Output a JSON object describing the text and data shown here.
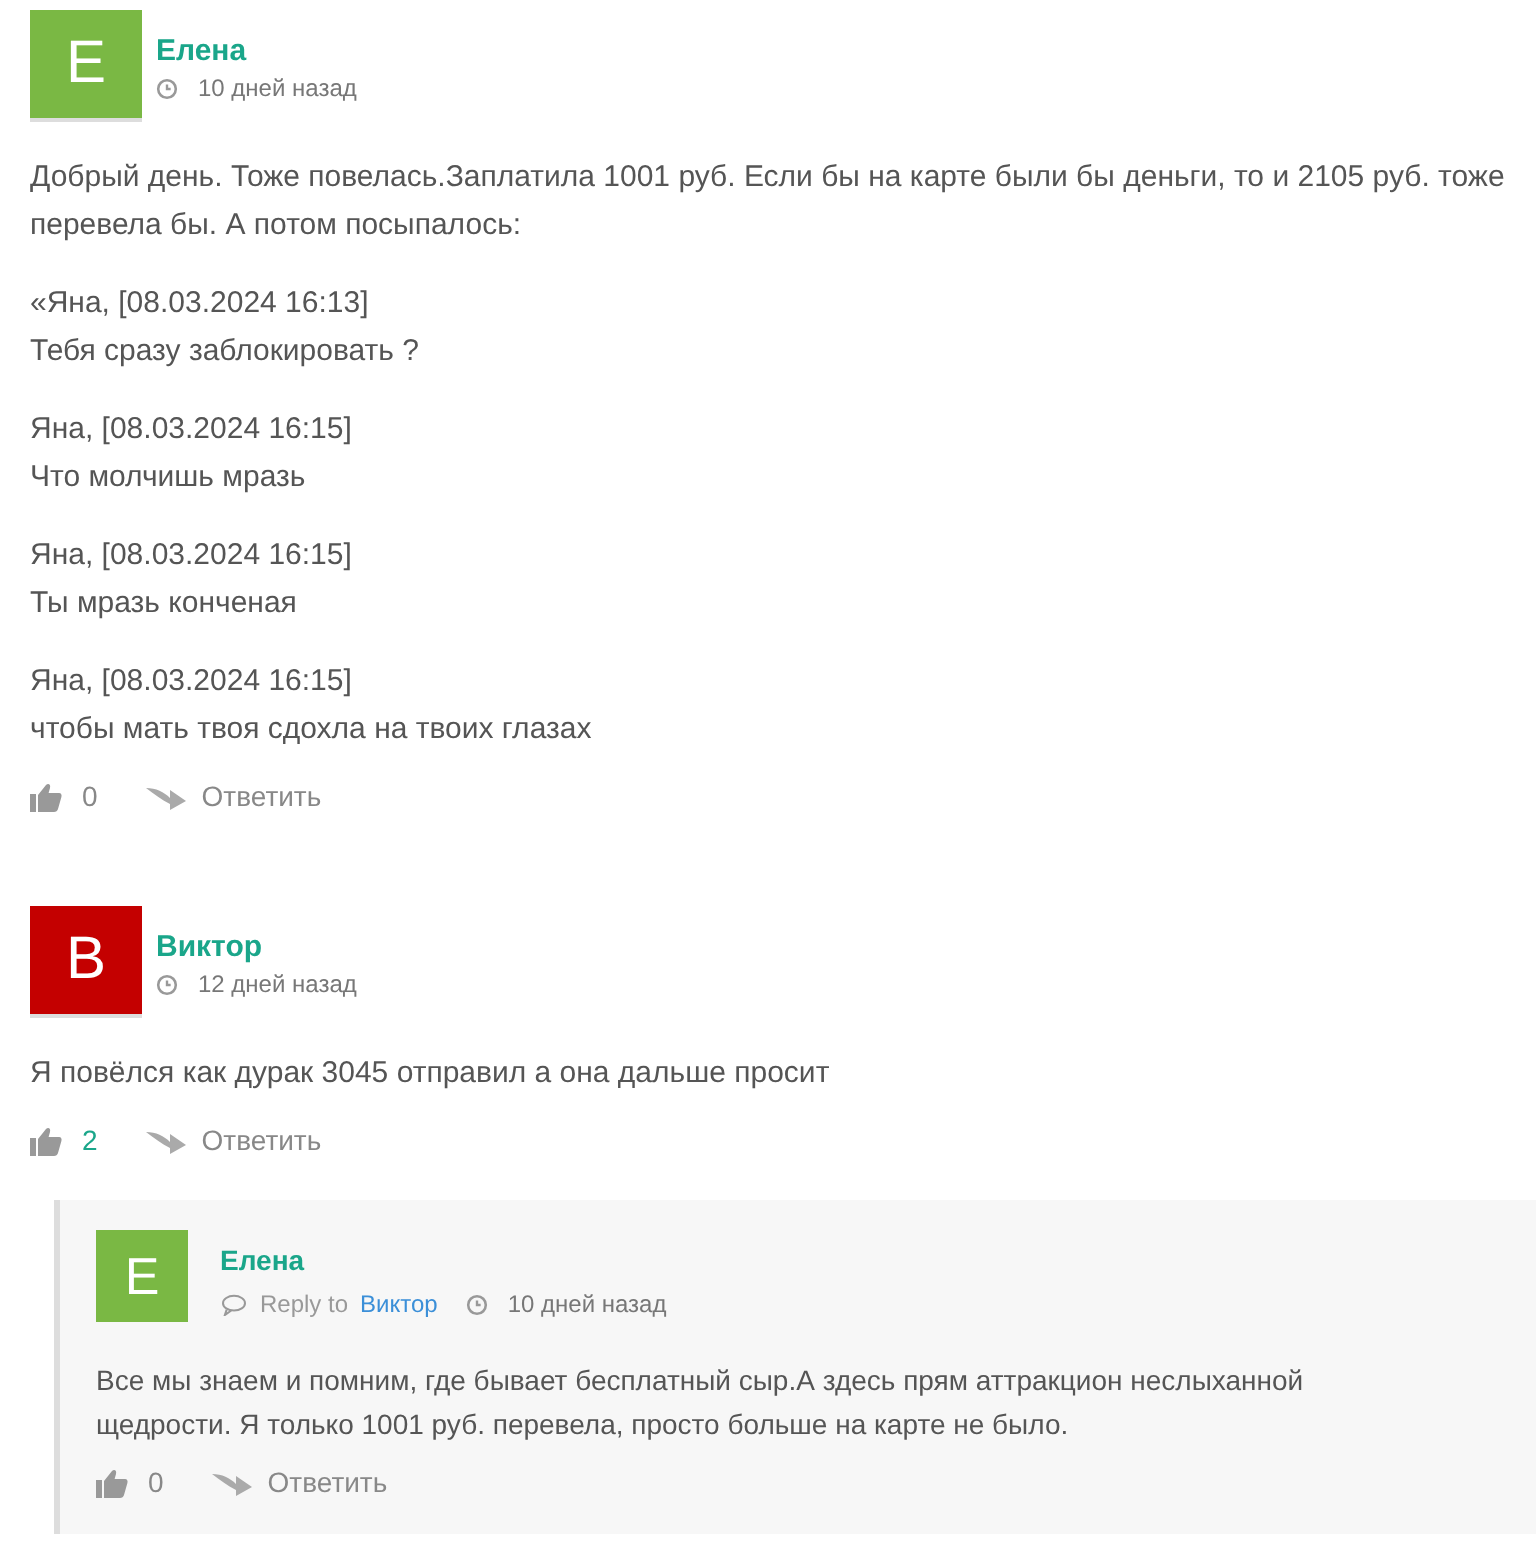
{
  "comments": [
    {
      "avatar_letter": "E",
      "color": "#7ab844",
      "author": "Елена",
      "time": "10 дней назад",
      "paragraphs": [
        "Добрый день. Тоже повелась.Заплатила 1001 руб. Если бы на карте были бы деньги, то и 2105 руб. тоже перевела бы. А потом посыпалось:",
        "«Яна, [08.03.2024 16:13]\nТебя сразу заблокировать ?",
        "Яна, [08.03.2024 16:15]\nЧто молчишь мразь",
        "Яна, [08.03.2024 16:15]\nТы мразь конченая",
        "Яна, [08.03.2024 16:15]\nчтобы мать твоя сдохла на твоих глазах"
      ],
      "likes": "0",
      "liked": false,
      "reply_label": "Ответить"
    },
    {
      "avatar_letter": "B",
      "color": "#c40000",
      "author": "Виктор",
      "time": "12 дней назад",
      "paragraphs": [
        "Я повёлся как дурак 3045 отправил а она дальше просит"
      ],
      "likes": "2",
      "liked": true,
      "reply_label": "Ответить",
      "replies": [
        {
          "avatar_letter": "E",
          "color": "#7ab844",
          "author": "Елена",
          "reply_to_label": "Reply to",
          "reply_to": "Виктор",
          "time": "10 дней назад",
          "paragraphs": [
            "Все мы знаем и помним, где бывает бесплатный сыр.А здесь прям аттракцион неслыханной щедрости. Я только 1001 руб. перевела, просто больше на карте не было."
          ],
          "likes": "0",
          "liked": false,
          "reply_label": "Ответить"
        }
      ]
    }
  ]
}
